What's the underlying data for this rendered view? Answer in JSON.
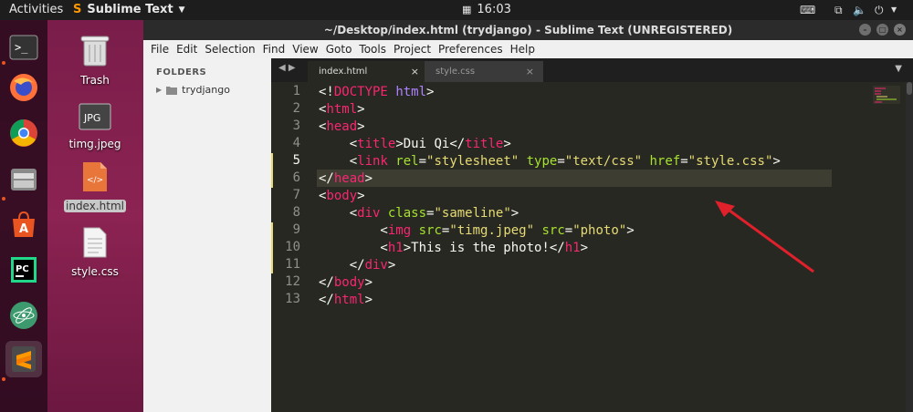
{
  "topbar": {
    "activities": "Activities",
    "app_name": "Sublime Text",
    "clock": "16:03"
  },
  "desktop": {
    "icons": [
      {
        "label": "Trash"
      },
      {
        "label": "timg.jpeg"
      },
      {
        "label": "index.html"
      },
      {
        "label": "style.css"
      }
    ],
    "jpg_badge": "JPG"
  },
  "window": {
    "title": "~/Desktop/index.html (trydjango) - Sublime Text (UNREGISTERED)",
    "menu": [
      "File",
      "Edit",
      "Selection",
      "Find",
      "View",
      "Goto",
      "Tools",
      "Project",
      "Preferences",
      "Help"
    ],
    "sidebar": {
      "heading": "FOLDERS",
      "folder": "trydjango"
    },
    "tabs": [
      {
        "label": "index.html",
        "close": "×"
      },
      {
        "label": "style.css",
        "close": "×"
      }
    ],
    "line_numbers": [
      "1",
      "2",
      "3",
      "4",
      "5",
      "6",
      "7",
      "8",
      "9",
      "10",
      "11",
      "12",
      "13"
    ]
  },
  "code": {
    "l1": {
      "a": "<!",
      "b": "DOCTYPE",
      "c": " ",
      "d": "html",
      "e": ">"
    },
    "l2": {
      "a": "<",
      "b": "html",
      "c": ">"
    },
    "l3": {
      "a": "<",
      "b": "head",
      "c": ">"
    },
    "l4": {
      "a": "    <",
      "b": "title",
      "c": ">Dui Qi</",
      "d": "title",
      "e": ">"
    },
    "l5": {
      "a": "    <",
      "b": "link",
      "c": " rel",
      "d": "=",
      "e": "\"stylesheet\"",
      "f": " type",
      "g": "=",
      "h": "\"text/css\"",
      "i": " href",
      "j": "=",
      "k": "\"style.css\"",
      "l": ">"
    },
    "l6": {
      "a": "</",
      "b": "head",
      "c": ">"
    },
    "l7": {
      "a": "<",
      "b": "body",
      "c": ">"
    },
    "l8": {
      "a": "    <",
      "b": "div",
      "c": " class",
      "d": "=",
      "e": "\"sameline\"",
      "f": ">"
    },
    "l9": {
      "a": "        <",
      "b": "img",
      "c": " src",
      "d": "=",
      "e": "\"timg.jpeg\"",
      "f": " src",
      "g": "=",
      "h": "\"photo\"",
      "i": ">"
    },
    "l10": {
      "a": "        <",
      "b": "h1",
      "c": ">This is the photo!</",
      "d": "h1",
      "e": ">"
    },
    "l11": {
      "a": "    </",
      "b": "div",
      "c": ">"
    },
    "l12": {
      "a": "</",
      "b": "body",
      "c": ">"
    },
    "l13": {
      "a": "</",
      "b": "html",
      "c": ">"
    }
  },
  "colors": {
    "tag": "#f92672",
    "attr": "#a6e22e",
    "string": "#e6db74",
    "arrow": "#e0202a"
  }
}
